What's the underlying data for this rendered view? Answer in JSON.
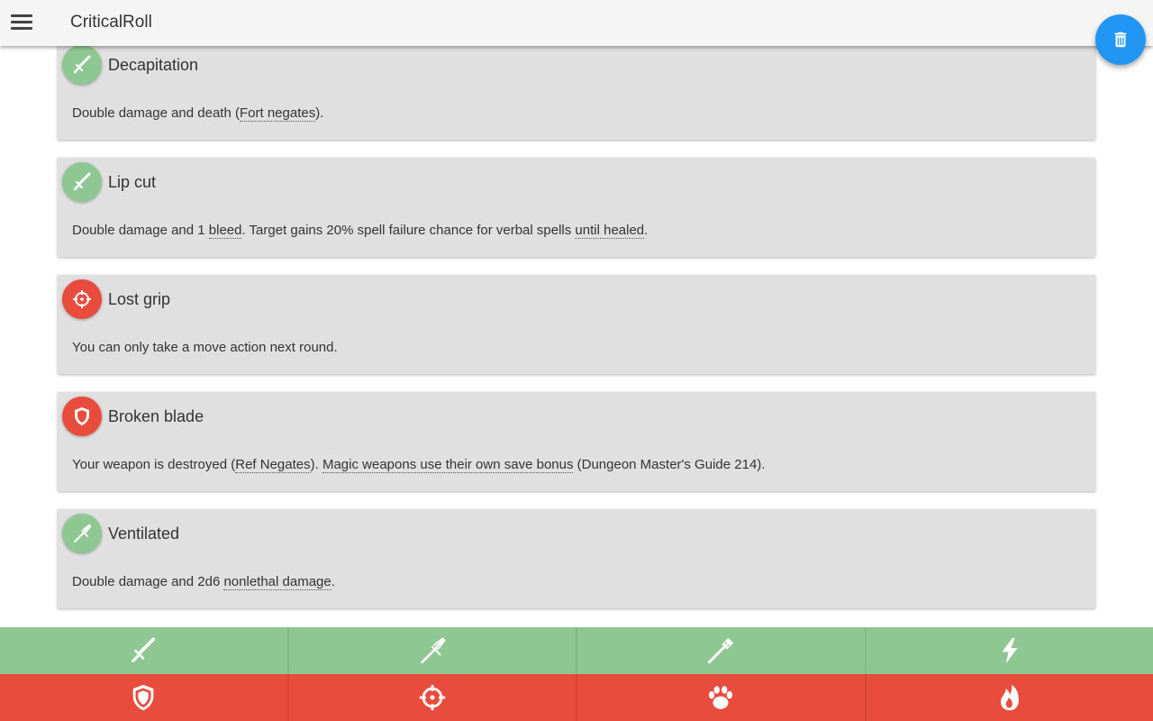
{
  "app": {
    "title": "CriticalRoll"
  },
  "fab": {
    "icon": "trash-icon"
  },
  "cards": [
    {
      "title": "Decapitation",
      "icon": "sword-icon",
      "color": "#8fc793",
      "desc": {
        "before": "Double damage and death (",
        "term1": "Fort negates",
        "after": ")."
      }
    },
    {
      "title": "Lip cut",
      "icon": "sword-icon",
      "color": "#8fc793",
      "desc": {
        "before": "Double damage and 1 ",
        "term1": "bleed",
        "middle": ". Target gains 20% spell failure chance for verbal spells ",
        "term2": "until healed",
        "after": "."
      }
    },
    {
      "title": "Lost grip",
      "icon": "crosshair-icon",
      "color": "#e84c3d",
      "desc": {
        "text": "You can only take a move action next round."
      }
    },
    {
      "title": "Broken blade",
      "icon": "shield-icon",
      "color": "#e84c3d",
      "desc": {
        "before": "Your weapon is destroyed (",
        "term1": "Ref Negates",
        "middle": "). ",
        "term2": "Magic weapons use their own save bonus",
        "after": " (Dungeon Master's Guide 214)."
      }
    },
    {
      "title": "Ventilated",
      "icon": "trident-icon",
      "color": "#8fc793",
      "desc": {
        "before": "Double damage and 2d6 ",
        "term1": "nonlethal damage",
        "after": "."
      }
    }
  ],
  "bottom_bar": {
    "weapons": [
      {
        "icon": "sword-icon"
      },
      {
        "icon": "trident-icon"
      },
      {
        "icon": "club-icon"
      },
      {
        "icon": "lightning-icon"
      }
    ],
    "fumbles": [
      {
        "icon": "shield-icon"
      },
      {
        "icon": "crosshair-icon"
      },
      {
        "icon": "paw-icon"
      },
      {
        "icon": "fire-icon"
      }
    ]
  },
  "colors": {
    "green": "#8fc793",
    "red": "#e84c3d",
    "fab": "#2196f3",
    "card": "#e0e0e0"
  }
}
